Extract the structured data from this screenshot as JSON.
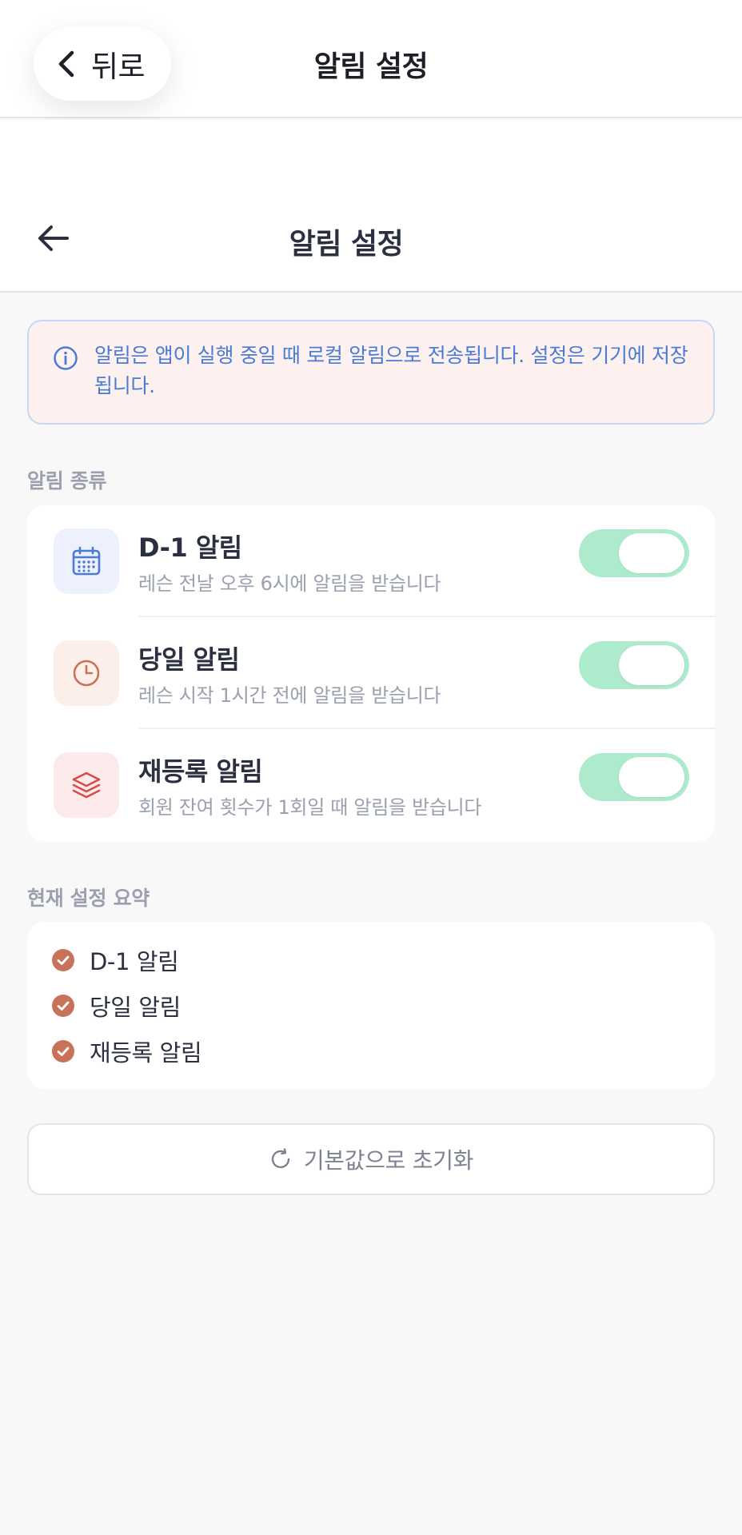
{
  "top_nav": {
    "back_label": "뒤로",
    "title": "알림 설정"
  },
  "header": {
    "title": "알림 설정"
  },
  "info_banner": {
    "text": "알림은 앱이 실행 중일 때 로컬 알림으로 전송됩니다. 설정은 기기에 저장됩니다."
  },
  "notification_types": {
    "section_label": "알림 종류",
    "items": [
      {
        "title": "D-1 알림",
        "description": "레슨 전날 오후 6시에 알림을 받습니다",
        "icon": "calendar-icon",
        "enabled": true
      },
      {
        "title": "당일 알림",
        "description": "레슨 시작 1시간 전에 알림을 받습니다",
        "icon": "clock-icon",
        "enabled": true
      },
      {
        "title": "재등록 알림",
        "description": "회원 잔여 횟수가 1회일 때 알림을 받습니다",
        "icon": "layers-icon",
        "enabled": true
      }
    ]
  },
  "summary": {
    "section_label": "현재 설정 요약",
    "items": [
      "D-1 알림",
      "당일 알림",
      "재등록 알림"
    ]
  },
  "reset_button": {
    "label": "기본값으로 초기화",
    "icon": "refresh-icon"
  },
  "colors": {
    "accent_green": "#aeebcd",
    "check_orange": "#c9725a",
    "info_blue": "#4a7bd6"
  }
}
